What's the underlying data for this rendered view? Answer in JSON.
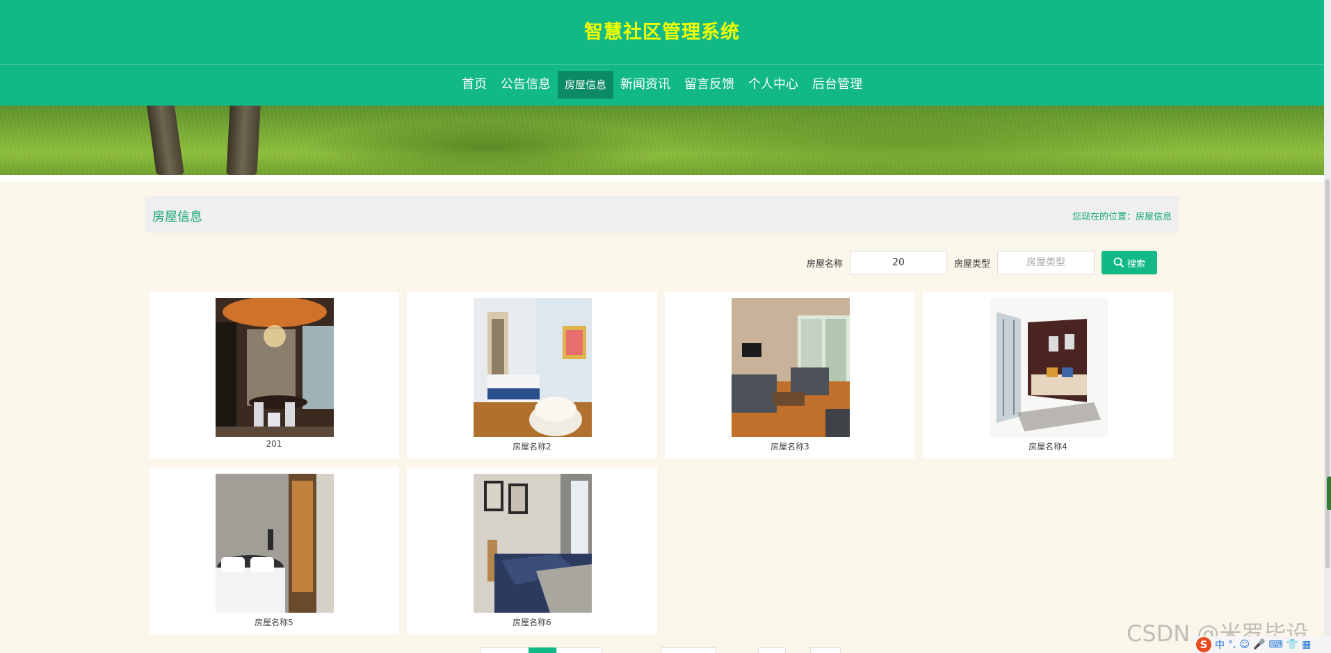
{
  "site": {
    "title": "智慧社区管理系统"
  },
  "nav": {
    "items": [
      {
        "label": "首页",
        "active": false
      },
      {
        "label": "公告信息",
        "active": false
      },
      {
        "label": "房屋信息",
        "active": true
      },
      {
        "label": "新闻资讯",
        "active": false
      },
      {
        "label": "留言反馈",
        "active": false
      },
      {
        "label": "个人中心",
        "active": false
      },
      {
        "label": "后台管理",
        "active": false
      }
    ]
  },
  "section": {
    "title": "房屋信息",
    "breadcrumb": "您现在的位置：房屋信息"
  },
  "search": {
    "name_label": "房屋名称",
    "name_value": "20",
    "type_label": "房屋类型",
    "type_placeholder": "房屋类型",
    "button_label": "搜索"
  },
  "houses": [
    {
      "name": "201"
    },
    {
      "name": "房屋名称2"
    },
    {
      "name": "房屋名称3"
    },
    {
      "name": "房屋名称4"
    },
    {
      "name": "房屋名称5"
    },
    {
      "name": "房屋名称6"
    }
  ],
  "overlay": {
    "watermark": "CSDN @米罗毕设",
    "ime_logo": "S",
    "ime_mode": "中"
  },
  "colors": {
    "primary": "#12b886",
    "nav_active": "#0b8a63",
    "title": "#f3ff00",
    "page_bg": "#fbf6ea"
  }
}
